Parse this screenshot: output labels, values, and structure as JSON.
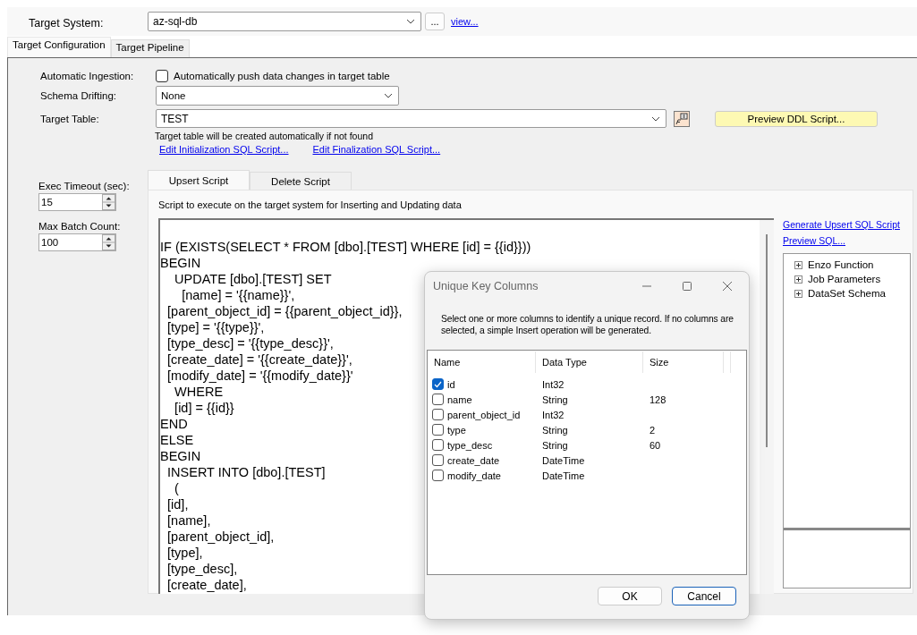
{
  "target_system": {
    "label": "Target System:",
    "value": "az-sql-db",
    "browse": "...",
    "link": "view..."
  },
  "tabs": [
    {
      "label": "Target Configuration",
      "selected": true
    },
    {
      "label": "Target Pipeline",
      "selected": false
    }
  ],
  "automatic_ingestion": {
    "label": "Automatic Ingestion:",
    "checkbox_label": "Automatically push data changes in target table",
    "checked": false
  },
  "schema_drifting": {
    "label": "Schema Drifting:",
    "value": "None"
  },
  "target_table": {
    "label": "Target Table:",
    "value": "TEST",
    "hint": "Target table will be created automatically if not found",
    "button": "Preview DDL Script..."
  },
  "script_links": [
    "Edit Initialization SQL Script...",
    "Edit Finalization SQL Script..."
  ],
  "exec_timeout": {
    "label": "Exec Timeout (sec):",
    "value": "15"
  },
  "max_batch_count": {
    "label": "Max Batch Count:",
    "value": "100"
  },
  "script_tabs": [
    {
      "label": "Upsert Script",
      "selected": true
    },
    {
      "label": "Delete Script",
      "selected": false
    }
  ],
  "script_description": "Script to execute on the target system for Inserting and Updating data",
  "script_lines": [
    "IF (EXISTS(SELECT * FROM [dbo].[TEST] WHERE [id] = {{id}}))",
    "BEGIN",
    "    UPDATE [dbo].[TEST] SET",
    "      [name] = '{{name}}',",
    "  [parent_object_id] = {{parent_object_id}},",
    "  [type] = '{{type}}',",
    "  [type_desc] = '{{type_desc}}',",
    "  [create_date] = '{{create_date}}',",
    "  [modify_date] = '{{modify_date}}'",
    "    WHERE",
    "    [id] = {{id}}",
    "END",
    "ELSE",
    "BEGIN",
    "  INSERT INTO [dbo].[TEST]",
    "    (",
    "  [id],",
    "  [name],",
    "  [parent_object_id],",
    "  [type],",
    "  [type_desc],",
    "  [create_date],"
  ],
  "side_links": [
    "Generate Upsert SQL Script",
    "Preview SQL..."
  ],
  "tree": [
    {
      "label": "Enzo Function",
      "expanded": false
    },
    {
      "label": "Job Parameters",
      "expanded": false
    },
    {
      "label": "DataSet Schema",
      "expanded": false
    }
  ],
  "dialog": {
    "title": "Unique Key Columns",
    "message": "Select one or more columns to identify a unique record. If no columns are selected, a simple Insert operation will be generated.",
    "columns": [
      "Name",
      "Data Type",
      "Size"
    ],
    "rows": [
      {
        "name": "id",
        "type": "Int32",
        "checked": true
      },
      {
        "name": "name",
        "type": "String",
        "size": "128",
        "checked": false
      },
      {
        "name": "parent_object_id",
        "type": "Int32",
        "checked": false
      },
      {
        "name": "type",
        "type": "String",
        "size": "2",
        "checked": false
      },
      {
        "name": "type_desc",
        "type": "String",
        "size": "60",
        "checked": false
      },
      {
        "name": "create_date",
        "type": "DateTime",
        "checked": false
      },
      {
        "name": "modify_date",
        "type": "DateTime",
        "checked": false
      }
    ],
    "buttons": [
      {
        "label": "OK",
        "default": false
      },
      {
        "label": "Cancel",
        "default": true
      }
    ]
  }
}
